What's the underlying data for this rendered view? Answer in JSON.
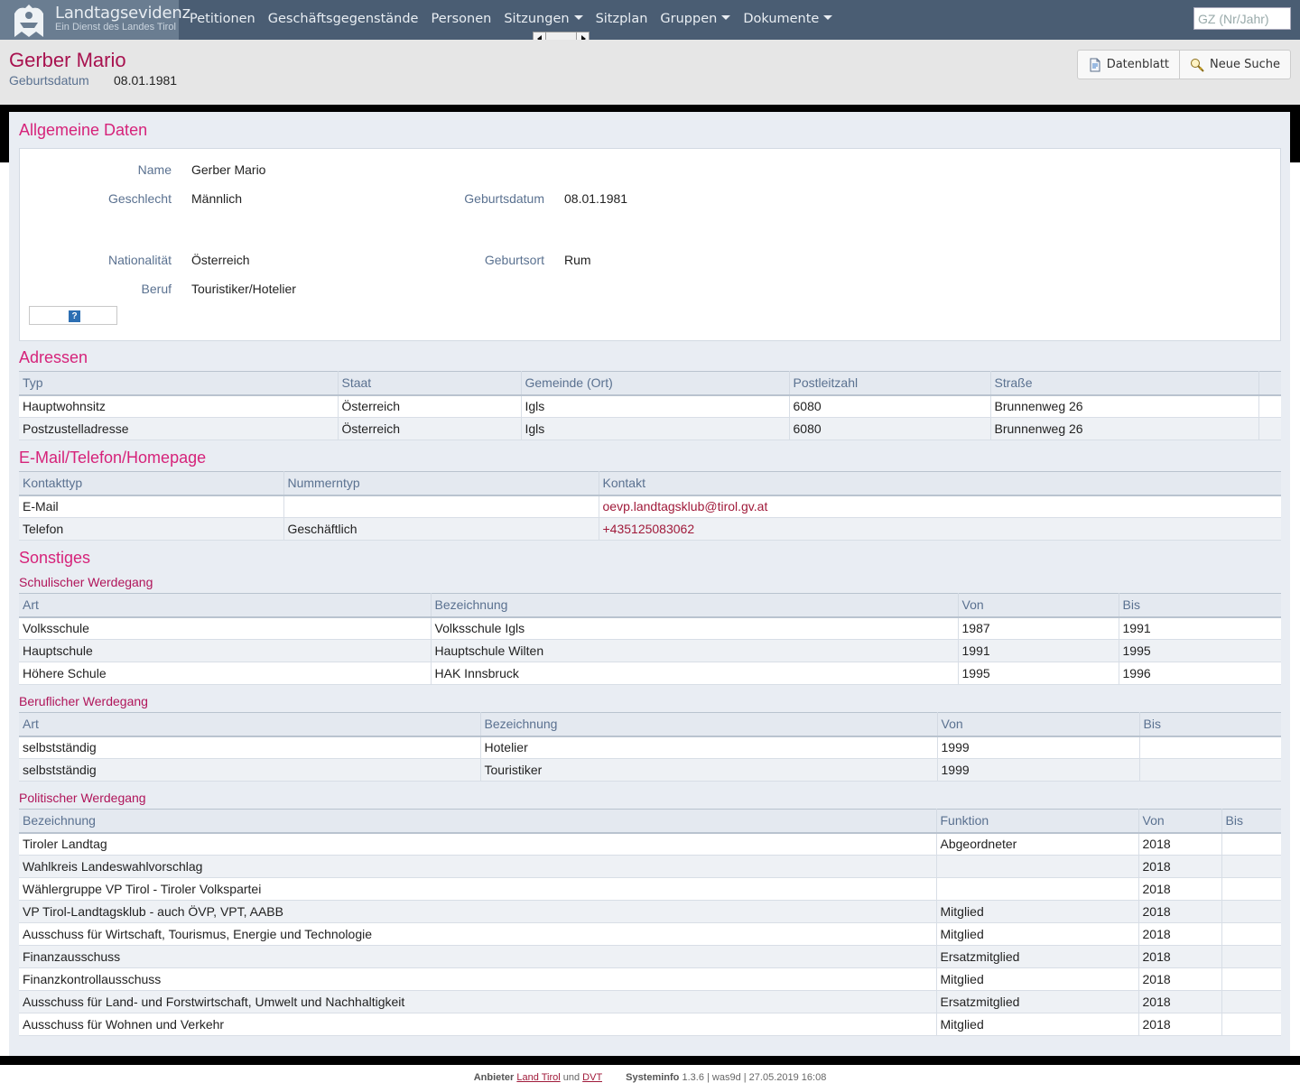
{
  "app": {
    "title": "Landtagsevidenz",
    "subtitle": "Ein Dienst des Landes Tirol"
  },
  "nav": [
    {
      "label": "Petitionen",
      "dropdown": false
    },
    {
      "label": "Geschäftsgegenstände",
      "dropdown": false
    },
    {
      "label": "Personen",
      "dropdown": false
    },
    {
      "label": "Sitzungen",
      "dropdown": true
    },
    {
      "label": "Sitzplan",
      "dropdown": false
    },
    {
      "label": "Gruppen",
      "dropdown": true
    },
    {
      "label": "Dokumente",
      "dropdown": true
    }
  ],
  "search": {
    "placeholder": "GZ (Nr/Jahr)",
    "value": ""
  },
  "header": {
    "name": "Gerber Mario",
    "birth_label": "Geburtsdatum",
    "birth_value": "08.01.1981",
    "btn_datenblatt": "Datenblatt",
    "btn_neue_suche": "Neue Suche"
  },
  "general": {
    "title": "Allgemeine Daten",
    "name_label": "Name",
    "name_value": "Gerber Mario",
    "gender_label": "Geschlecht",
    "gender_value": "Männlich",
    "birth_label": "Geburtsdatum",
    "birth_value": "08.01.1981",
    "nat_label": "Nationalität",
    "nat_value": "Österreich",
    "place_label": "Geburtsort",
    "place_value": "Rum",
    "job_label": "Beruf",
    "job_value": "Touristiker/Hotelier",
    "image_icon": "question-mark-icon"
  },
  "addresses": {
    "title": "Adressen",
    "columns": [
      "Typ",
      "Staat",
      "Gemeinde (Ort)",
      "Postleitzahl",
      "Straße",
      ""
    ],
    "rows": [
      [
        "Hauptwohnsitz",
        "Österreich",
        "Igls",
        "6080",
        "Brunnenweg 26",
        ""
      ],
      [
        "Postzustelladresse",
        "Österreich",
        "Igls",
        "6080",
        "Brunnenweg 26",
        ""
      ]
    ]
  },
  "contacts": {
    "title": "E-Mail/Telefon/Homepage",
    "columns": [
      "Kontakttyp",
      "Nummerntyp",
      "Kontakt"
    ],
    "rows": [
      [
        "E-Mail",
        "",
        "oevp.landtagsklub@tirol.gv.at"
      ],
      [
        "Telefon",
        "Geschäftlich",
        "+435125083062"
      ]
    ]
  },
  "misc": {
    "title": "Sonstiges",
    "school": {
      "title": "Schulischer Werdegang",
      "columns": [
        "Art",
        "Bezeichnung",
        "Von",
        "Bis"
      ],
      "rows": [
        [
          "Volksschule",
          "Volksschule Igls",
          "1987",
          "1991"
        ],
        [
          "Hauptschule",
          "Hauptschule Wilten",
          "1991",
          "1995"
        ],
        [
          "Höhere Schule",
          "HAK Innsbruck",
          "1995",
          "1996"
        ]
      ]
    },
    "career": {
      "title": "Beruflicher Werdegang",
      "columns": [
        "Art",
        "Bezeichnung",
        "Von",
        "Bis"
      ],
      "rows": [
        [
          "selbstständig",
          "Hotelier",
          "1999",
          ""
        ],
        [
          "selbstständig",
          "Touristiker",
          "1999",
          ""
        ]
      ]
    },
    "political": {
      "title": "Politischer Werdegang",
      "columns": [
        "Bezeichnung",
        "Funktion",
        "Von",
        "Bis"
      ],
      "rows": [
        [
          "Tiroler Landtag",
          "Abgeordneter",
          "2018",
          ""
        ],
        [
          "Wahlkreis Landeswahlvorschlag",
          "",
          "2018",
          ""
        ],
        [
          "Wählergruppe VP Tirol - Tiroler Volkspartei",
          "",
          "2018",
          ""
        ],
        [
          "VP Tirol-Landtagsklub - auch ÖVP, VPT, AABB",
          "Mitglied",
          "2018",
          ""
        ],
        [
          "Ausschuss für Wirtschaft, Tourismus, Energie und Technologie",
          "Mitglied",
          "2018",
          ""
        ],
        [
          "Finanzausschuss",
          "Ersatzmitglied",
          "2018",
          ""
        ],
        [
          "Finanzkontrollausschuss",
          "Mitglied",
          "2018",
          ""
        ],
        [
          "Ausschuss für Land- und Forstwirtschaft, Umwelt und Nachhaltigkeit",
          "Ersatzmitglied",
          "2018",
          ""
        ],
        [
          "Ausschuss für Wohnen und Verkehr",
          "Mitglied",
          "2018",
          ""
        ]
      ]
    }
  },
  "footer": {
    "provider_label": "Anbieter",
    "provider_1": "Land Tirol",
    "and": "und",
    "provider_2": "DVT",
    "sysinfo_label": "Systeminfo",
    "sysinfo_value": "1.3.6 | was9d | 27.05.2019 16:08"
  }
}
